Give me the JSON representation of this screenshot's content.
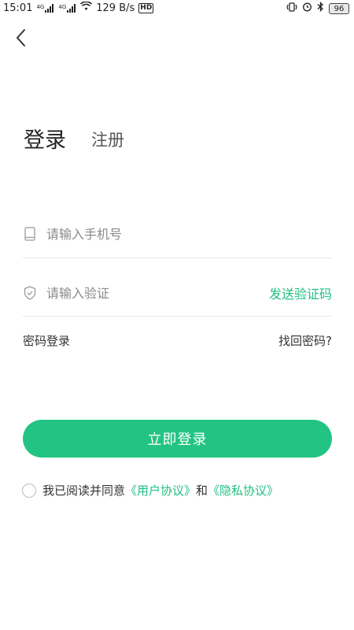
{
  "status_bar": {
    "time": "15:01",
    "network_1": "4G",
    "network_2": "4G",
    "speed": "129 B/s",
    "hd": "HD",
    "battery": "96"
  },
  "header": {
    "back_icon": "chevron-left-icon"
  },
  "tabs": {
    "login": "登录",
    "register": "注册"
  },
  "form": {
    "phone_placeholder": "请输入手机号",
    "phone_value": "",
    "phone_icon": "phone-icon",
    "code_placeholder": "请输入验证",
    "code_value": "",
    "code_icon": "shield-icon",
    "send_code": "发送验证码"
  },
  "links": {
    "password_login": "密码登录",
    "forgot_password": "找回密码?"
  },
  "login_button": "立即登录",
  "agreement": {
    "prefix": "我已阅读并同意",
    "user_agreement": "《用户协议》",
    "and": "和",
    "privacy_policy": "《隐私协议》",
    "checked": false
  },
  "colors": {
    "accent": "#23c483",
    "link": "#1fbf83",
    "divider": "#e6e6e6"
  }
}
